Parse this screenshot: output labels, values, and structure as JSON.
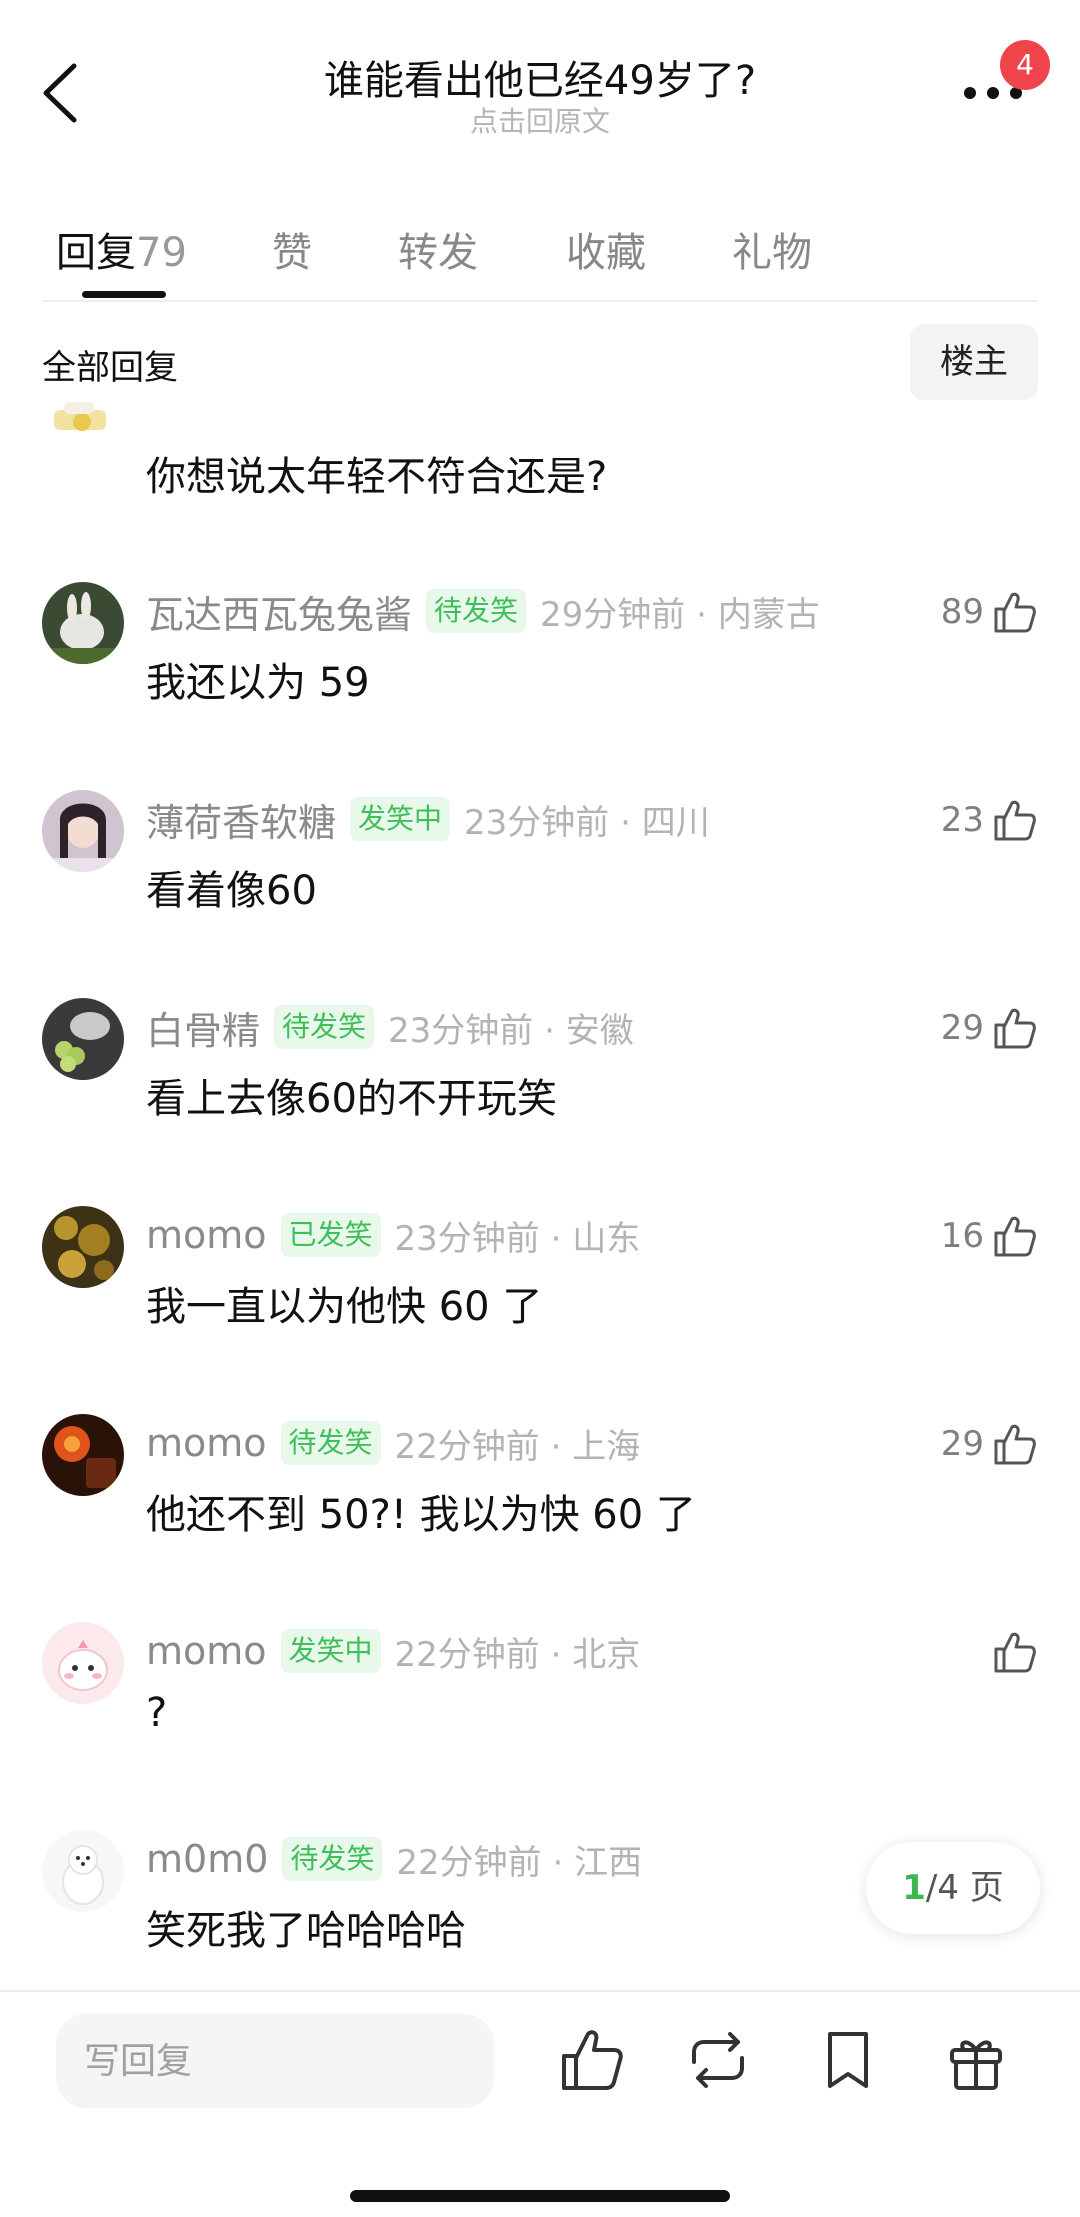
{
  "header": {
    "title": "谁能看出他已经49岁了?",
    "subtitle": "点击回原文",
    "notification_count": "4"
  },
  "tabs": [
    {
      "label": "回复",
      "count": "79"
    },
    {
      "label": "赞"
    },
    {
      "label": "转发"
    },
    {
      "label": "收藏"
    },
    {
      "label": "礼物"
    }
  ],
  "section": {
    "title": "全部回复",
    "floor_button": "楼主"
  },
  "partial_comment": {
    "text": "你想说太年轻不符合还是?"
  },
  "comments": [
    {
      "username": "瓦达西瓦兔兔酱",
      "tag": "待发笑",
      "time": "29分钟前 · 内蒙古",
      "text": "我还以为 59",
      "likes": "89"
    },
    {
      "username": "薄荷香软糖",
      "tag": "发笑中",
      "time": "23分钟前 · 四川",
      "text": "看着像60",
      "likes": "23"
    },
    {
      "username": "白骨精",
      "tag": "待发笑",
      "time": "23分钟前 · 安徽",
      "text": "看上去像60的不开玩笑",
      "likes": "29"
    },
    {
      "username": "momo",
      "tag": "已发笑",
      "time": "23分钟前 · 山东",
      "text": "我一直以为他快 60 了",
      "likes": "16"
    },
    {
      "username": "momo",
      "tag": "待发笑",
      "time": "22分钟前 · 上海",
      "text": "他还不到 50?! 我以为快 60 了",
      "likes": "29"
    },
    {
      "username": "momo",
      "tag": "发笑中",
      "time": "22分钟前 · 北京",
      "text": "?",
      "likes": ""
    },
    {
      "username": "m0m0",
      "tag": "待发笑",
      "time": "22分钟前 · 江西",
      "text": "笑死我了哈哈哈哈",
      "likes": ""
    }
  ],
  "pager": {
    "current": "1",
    "total_text": "/4 页"
  },
  "bottom_bar": {
    "reply_placeholder": "写回复",
    "icons": [
      "like-icon",
      "repost-icon",
      "bookmark-icon",
      "gift-icon"
    ]
  },
  "colors": {
    "tag_text": "#3fbf5a",
    "tag_bg": "#e8f8ea",
    "badge": "#f0444c",
    "pager_current": "#3db84f"
  }
}
